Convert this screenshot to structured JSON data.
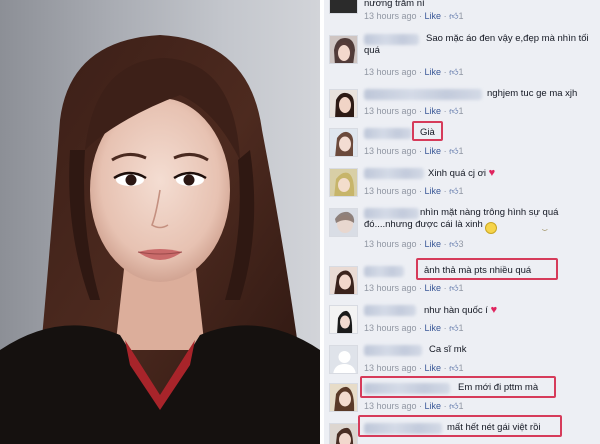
{
  "photo": {
    "alt": "portrait photo"
  },
  "comments": [
    {
      "text": "nương trăm nì",
      "time": "13 hours ago",
      "like": "Like",
      "likes": "1"
    },
    {
      "text": "Sao mặc áo đen vậy e,đẹp mà nhìn tối quá",
      "time": "13 hours ago",
      "like": "Like",
      "likes": "1"
    },
    {
      "text": "nghjem tuc ge ma xjh",
      "time": "13 hours ago",
      "like": "Like",
      "likes": "1"
    },
    {
      "text": "Già",
      "time": "13 hours ago",
      "like": "Like",
      "likes": "1"
    },
    {
      "text": "Xinh quá cj ơi",
      "time": "13 hours ago",
      "like": "Like",
      "likes": "1"
    },
    {
      "text": "nhìn mặt nàng trông hình sự quá đó....nhưng được cái là xinh",
      "time": "13 hours ago",
      "like": "Like",
      "likes": "3"
    },
    {
      "text": "ảnh thả mà pts nhiều quá",
      "time": "13 hours ago",
      "like": "Like",
      "likes": "1"
    },
    {
      "text": "như hàn quốc í",
      "time": "13 hours ago",
      "like": "Like",
      "likes": "1"
    },
    {
      "text": "Ca sĩ mk",
      "time": "13 hours ago",
      "like": "Like",
      "likes": "1"
    },
    {
      "text": "Em mới đi pttm mà",
      "time": "13 hours ago",
      "like": "Like",
      "likes": "1"
    },
    {
      "text": "mất hết nét gái việt rồi",
      "time": "",
      "like": "",
      "likes": ""
    }
  ],
  "colors": {
    "panel_bg": "#edeff4",
    "link": "#3b5998",
    "meta": "#9197a3",
    "highlight": "#d63b5a"
  }
}
